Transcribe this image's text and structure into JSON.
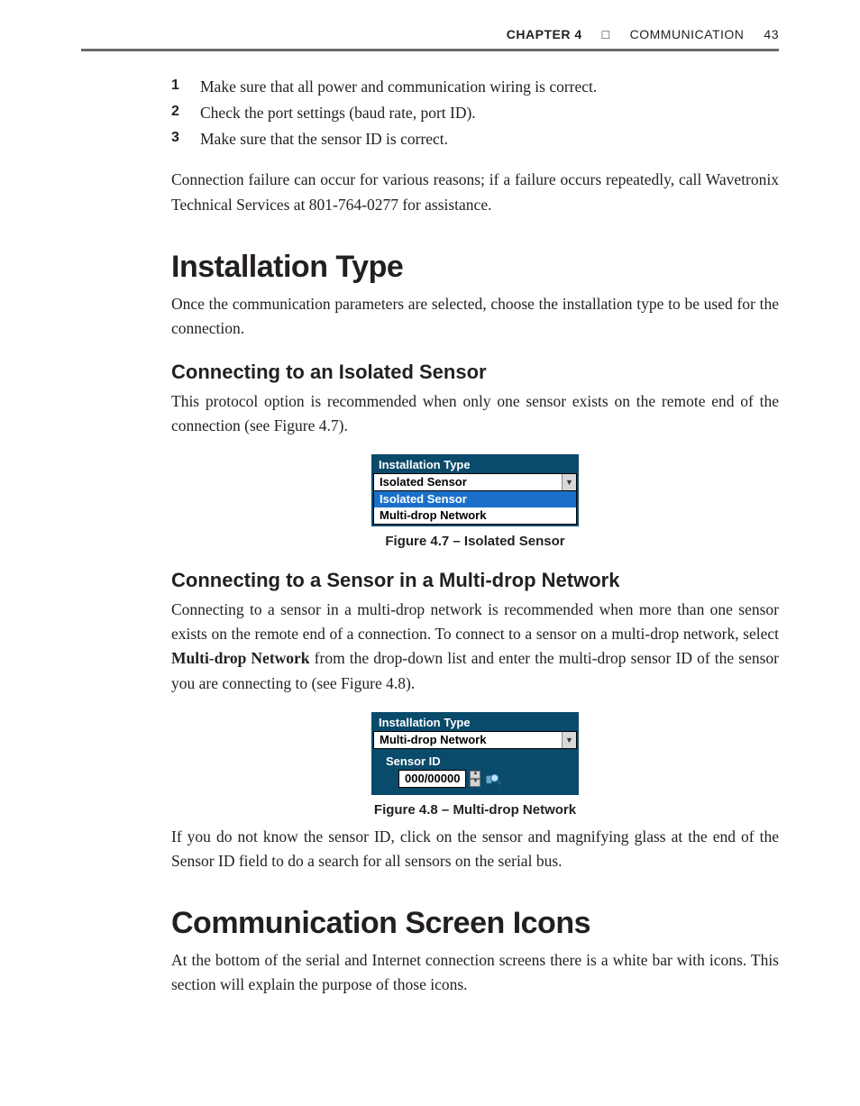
{
  "header": {
    "chapter_label": "CHAPTER 4",
    "square": "□",
    "title": "COMMUNICATION",
    "page": "43"
  },
  "steps": [
    {
      "num": "1",
      "text": "Make sure that all power and communication wiring is correct."
    },
    {
      "num": "2",
      "text": "Check the port settings (baud rate, port ID)."
    },
    {
      "num": "3",
      "text": "Make sure that the sensor ID is correct."
    }
  ],
  "para_fail": "Connection failure can occur for various reasons; if a failure occurs repeatedly, call Wavetronix Technical Services at 801-764-0277 for assistance.",
  "h1_install": "Installation Type",
  "para_install": "Once the communication parameters are selected, choose the installation type to be used for the connection.",
  "h2_isolated": "Connecting to an Isolated Sensor",
  "para_isolated": "This protocol option is recommended when only one sensor exists on the remote end of the connection (see Figure 4.7).",
  "fig47": {
    "panel_title": "Installation Type",
    "selected_value": "Isolated Sensor",
    "option_selected": "Isolated Sensor",
    "option_other": "Multi-drop Network",
    "caption": "Figure 4.7 – Isolated Sensor"
  },
  "h2_multidrop": "Connecting to a Sensor in a Multi-drop Network",
  "para_multidrop_pre": "Connecting to a sensor in a multi-drop network is recommended when more than one sensor exists on the remote end of a connection. To connect to a sensor on a multi-drop network, select ",
  "para_multidrop_bold": "Multi-drop Network",
  "para_multidrop_post": " from the drop-down list and enter the multi-drop sensor ID of the sensor you are connecting to (see Figure 4.8).",
  "fig48": {
    "panel_title": "Installation Type",
    "selected_value": "Multi-drop Network",
    "sensor_label": "Sensor ID",
    "sensor_value": "000/00000",
    "caption": "Figure 4.8 – Multi-drop Network"
  },
  "para_search": "If you do not know the sensor ID, click on the sensor and magnifying glass at the end of the Sensor ID field to do a search for all sensors on the serial bus.",
  "h1_icons": "Communication Screen Icons",
  "para_icons": "At the bottom of the serial and Internet connection screens there is a white bar with icons. This section will explain the purpose of those icons."
}
